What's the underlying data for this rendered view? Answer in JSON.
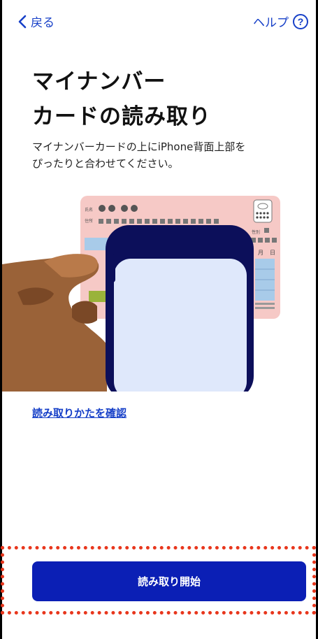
{
  "nav": {
    "back_label": "戻る",
    "help_label": "ヘルプ",
    "help_icon_glyph": "?"
  },
  "main": {
    "title": "マイナンバー\nカードの読み取り",
    "description": "マイナンバーカードの上にiPhone背面上部を\nぴったりと合わせてください。",
    "card_labels": {
      "name": "氏名",
      "address": "住所",
      "sex": "性別",
      "month": "月",
      "day": "日"
    },
    "help_link": "読み取りかたを確認"
  },
  "footer": {
    "start_button": "読み取り開始"
  },
  "colors": {
    "accent": "#1740c8",
    "button": "#0b1fb5",
    "focus_outline": "#e8361c",
    "card": "#f6c9c6",
    "phone": "#0c0f5a",
    "hand": "#b97a4a"
  }
}
